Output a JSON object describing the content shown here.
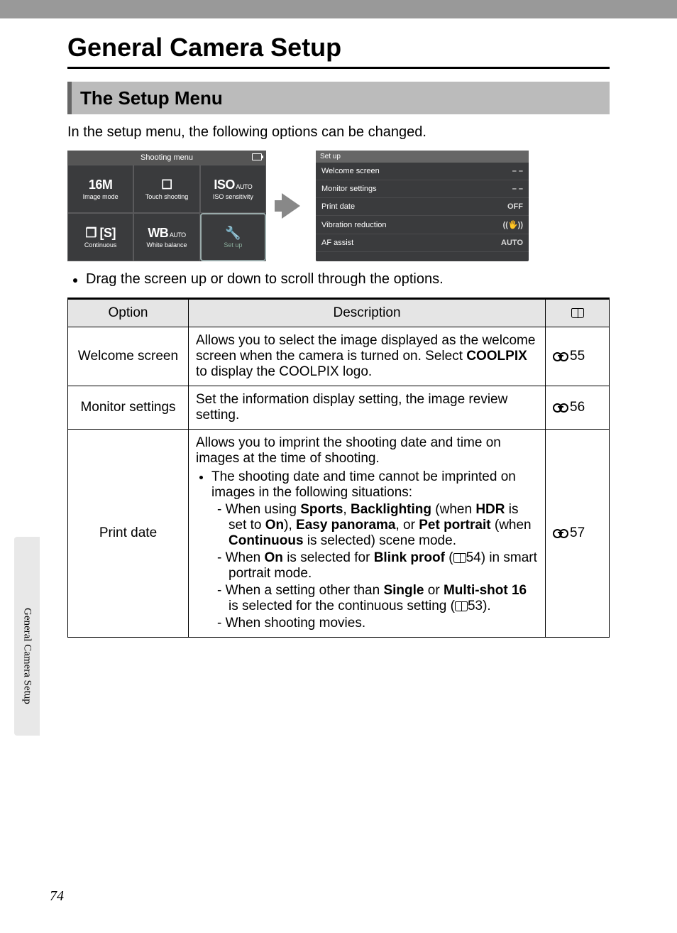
{
  "title": "General Camera Setup",
  "section_title": "The Setup Menu",
  "intro": "In the setup menu, the following options can be changed.",
  "bullet_after_screens": "Drag the screen up or down to scroll through the options.",
  "side_tab": "General Camera Setup",
  "page_number": "74",
  "lcd1": {
    "title": "Shooting menu",
    "cells": [
      {
        "icon": "16M",
        "label": "Image mode"
      },
      {
        "icon": "☐",
        "label": "Touch shooting"
      },
      {
        "icon": "ISO",
        "icon_sub": "AUTO",
        "label": "ISO sensitivity"
      },
      {
        "icon": "❐ [S]",
        "label": "Continuous"
      },
      {
        "icon": "WB",
        "icon_sub": "AUTO",
        "label": "White balance"
      },
      {
        "icon": "🔧",
        "label": "Set up",
        "setup": true
      }
    ]
  },
  "lcd2": {
    "title": "Set up",
    "rows": [
      {
        "label": "Welcome screen",
        "val": "– –"
      },
      {
        "label": "Monitor settings",
        "val": "– –"
      },
      {
        "label": "Print date",
        "val": "OFF"
      },
      {
        "label": "Vibration reduction",
        "val": "((🖐))"
      },
      {
        "label": "AF assist",
        "val": "AUTO"
      }
    ]
  },
  "table": {
    "headers": {
      "opt": "Option",
      "desc": "Description"
    },
    "rows": [
      {
        "opt": "Welcome screen",
        "ref": "55",
        "desc_html": "Allows you to select the image displayed as the welcome screen when the camera is turned on. Select <span class=\"bold\">COOLPIX</span> to display the COOLPIX logo."
      },
      {
        "opt": "Monitor settings",
        "ref": "56",
        "desc_html": "Set the information display setting, the image review setting."
      },
      {
        "opt": "Print date",
        "ref": "57",
        "desc_html": "Allows you to imprint the shooting date and time on images at the time of shooting.<ul><li>The shooting date and time cannot be imprinted on images in the following situations:<ul class=\"dash-list\"><li>When using <span class=\"bold\">Sports</span>, <span class=\"bold\">Backlighting</span> (when <span class=\"bold\">HDR</span> is set to <span class=\"bold\">On</span>), <span class=\"bold\">Easy panorama</span>, or <span class=\"bold\">Pet portrait</span> (when <span class=\"bold\">Continuous</span> is selected) scene mode.</li><li>When <span class=\"bold\">On</span> is selected for <span class=\"bold\">Blink proof</span> (<span class=\"book-icon\"></span>54) in smart portrait mode.</li><li>When a setting other than <span class=\"bold\">Single</span> or <span class=\"bold\">Multi-shot 16</span> is selected for the continuous setting (<span class=\"book-icon\"></span>53).</li><li>When shooting movies.</li></ul></li></ul>"
      }
    ]
  }
}
